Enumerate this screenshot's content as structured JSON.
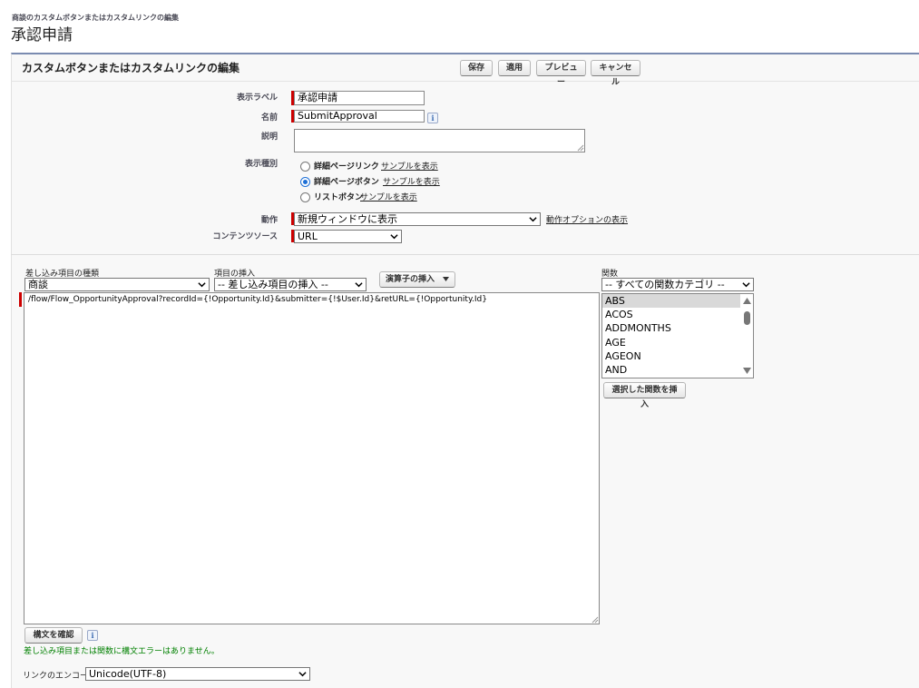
{
  "breadcrumb": "商談のカスタムボタンまたはカスタムリンクの編集",
  "page_title": "承認申請",
  "section_title": "カスタムボタンまたはカスタムリンクの編集",
  "toolbar": {
    "save": "保存",
    "apply": "適用",
    "preview": "プレビュー",
    "cancel": "キャンセル"
  },
  "form": {
    "label_label": "表示ラベル",
    "label_value": "承認申請",
    "name_label": "名前",
    "name_value": "SubmitApproval",
    "description_label": "説明",
    "description_value": "",
    "display_type_label": "表示種別",
    "display_types": [
      {
        "label": "詳細ページリンク",
        "sample": "サンプルを表示",
        "selected": false
      },
      {
        "label": "詳細ページボタン",
        "sample": "サンプルを表示",
        "selected": true
      },
      {
        "label": "リストボタン",
        "sample": "サンプルを表示",
        "selected": false
      }
    ],
    "behavior_label": "動作",
    "behavior_value": "新規ウィンドウに表示",
    "behavior_link": "動作オプションの表示",
    "content_source_label": "コンテンツソース",
    "content_source_value": "URL"
  },
  "formula": {
    "merge_type_label": "差し込み項目の種類",
    "merge_type_value": "商談",
    "insert_field_label": "項目の挿入",
    "insert_field_value": "-- 差し込み項目の挿入 --",
    "insert_operator": "演算子の挿入",
    "functions_label": "関数",
    "functions_category": "-- すべての関数カテゴリ --",
    "functions": [
      "ABS",
      "ACOS",
      "ADDMONTHS",
      "AGE",
      "AGEON",
      "AND"
    ],
    "selected_function": "ABS",
    "insert_function_button": "選択した関数を挿入",
    "body": "/flow/Flow_OpportunityApproval?recordId={!Opportunity.Id}&submitter={!$User.Id}&retURL={!Opportunity.Id}",
    "check_syntax_button": "構文を確認",
    "status": "差し込み項目または関数に構文エラーはありません。"
  },
  "encoding": {
    "label": "リンクのエンコード",
    "value": "Unicode(UTF-8)"
  },
  "colors": {
    "required": "#cc0000",
    "header_rule": "#7a8bb0",
    "status_ok": "#008000"
  }
}
